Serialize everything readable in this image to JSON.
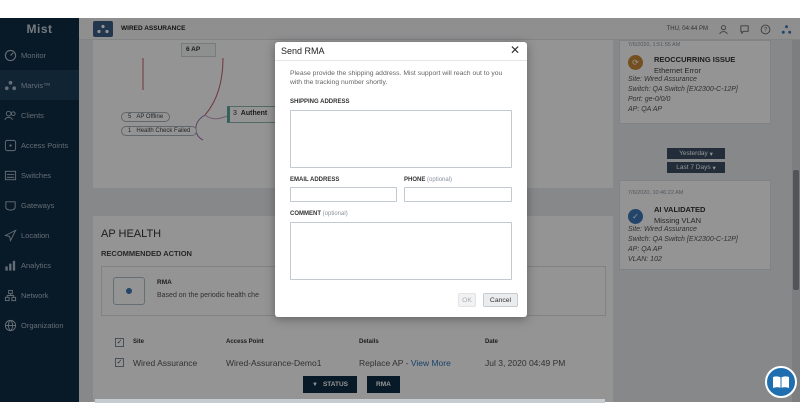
{
  "sidebar": {
    "logo": "Mist",
    "items": [
      {
        "label": "Monitor",
        "icon": "monitor-icon"
      },
      {
        "label": "Marvis™",
        "icon": "marvis-icon"
      },
      {
        "label": "Clients",
        "icon": "clients-icon"
      },
      {
        "label": "Access Points",
        "icon": "access-point-icon"
      },
      {
        "label": "Switches",
        "icon": "switch-icon"
      },
      {
        "label": "Gateways",
        "icon": "gateway-icon"
      },
      {
        "label": "Location",
        "icon": "location-icon"
      },
      {
        "label": "Analytics",
        "icon": "analytics-icon"
      },
      {
        "label": "Network",
        "icon": "network-icon"
      },
      {
        "label": "Organization",
        "icon": "organization-icon"
      }
    ]
  },
  "topbar": {
    "site": "WIRED ASSURANCE",
    "datetime": "THU, 04:44 PM"
  },
  "flow": {
    "ap_node": "6 AP",
    "ap_offline": {
      "count": "5",
      "label": "AP Offline"
    },
    "health_failed": {
      "count": "1",
      "label": "Health Check Failed"
    },
    "auth_node": {
      "count": "3",
      "label": "Authent"
    }
  },
  "ap_health": {
    "title": "AP HEALTH",
    "recommended": "RECOMMENDED ACTION",
    "rec_label": "RMA",
    "rec_text": "Based on the periodic health che",
    "table": {
      "headers": [
        "Site",
        "Access Point",
        "Details",
        "Date"
      ],
      "rows": [
        {
          "site": "Wired Assurance",
          "ap": "Wired-Assurance-Demo1",
          "details": "Replace AP - ",
          "link": "View More",
          "date": "Jul 3, 2020 04:49 PM"
        }
      ]
    },
    "status_btn": "STATUS",
    "rma_btn": "RMA"
  },
  "right": {
    "card1": {
      "timestamp": "7/6/2020, 1:51:55 AM",
      "title": "REOCCURRING ISSUE",
      "subtitle": "Ethernet Error",
      "lines": [
        "Site: Wired Assurance",
        "Switch: QA Switch [EX2300-C-12P]",
        "Port: ge-0/0/0",
        "AP: QA AP"
      ]
    },
    "dropdown1": "Yesterday",
    "dropdown2": "Last 7 Days",
    "card2": {
      "timestamp": "7/6/2020, 10:46:22 AM",
      "title": "AI VALIDATED",
      "subtitle": "Missing VLAN",
      "lines": [
        "Site: Wired Assurance",
        "Switch: QA Switch [EX2300-C-12P]",
        "AP: QA AP",
        "VLAN: 102"
      ]
    }
  },
  "modal": {
    "title": "Send RMA",
    "close": "✕",
    "description": "Please provide the shipping address. Mist support will reach out to you with the tracking number shortly.",
    "shipping_label": "SHIPPING ADDRESS",
    "email_label": "EMAIL ADDRESS",
    "phone_label": "PHONE",
    "phone_optional": "(optional)",
    "comment_label": "COMMENT",
    "comment_optional": "(optional)",
    "ok": "OK",
    "cancel": "Cancel"
  },
  "colors": {
    "sidebar": "#0f2d44",
    "accent": "#2d70b5",
    "overlay": "rgba(0,0,0,0.42)"
  }
}
